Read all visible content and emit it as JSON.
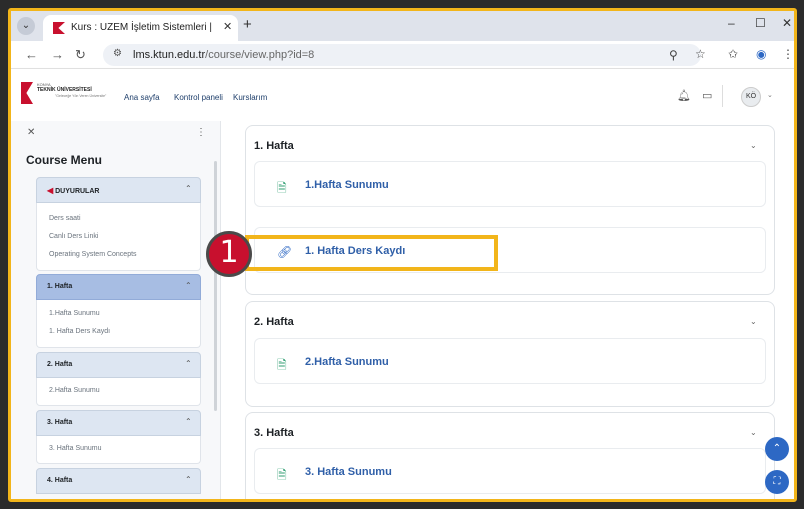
{
  "colors": {
    "accent": "#2d68c4",
    "brand": "#c8102e",
    "highlight": "#f2b51a"
  },
  "browser": {
    "tab_title": "Kurs : UZEM İşletim Sistemleri |",
    "url_host": "lms.ktun.edu.tr",
    "url_path": "/course/view.php?id=8"
  },
  "site": {
    "logo_small": "KONYA",
    "logo_big": "TEKNİK ÜNİVERSİTESİ",
    "logo_tagline": "\"Geleceğe Yön Veren Üniversite\"",
    "nav": [
      "Ana sayfa",
      "Kontrol paneli",
      "Kurslarım"
    ],
    "avatar_initials": "KÖ"
  },
  "drawer": {
    "title": "Course Menu",
    "sections": [
      {
        "label": "DUYURULAR",
        "items": [
          "Ders saati",
          "Canlı Ders Linki",
          "Operating System Concepts"
        ]
      },
      {
        "label": "1. Hafta",
        "active": true,
        "items": [
          "1.Hafta Sunumu",
          "1. Hafta Ders Kaydı"
        ]
      },
      {
        "label": "2. Hafta",
        "items": [
          "2.Hafta Sunumu"
        ]
      },
      {
        "label": "3. Hafta",
        "items": [
          "3. Hafta Sunumu"
        ]
      },
      {
        "label": "4. Hafta",
        "items": []
      }
    ]
  },
  "main": {
    "weeks": [
      {
        "title": "1. Hafta",
        "activities": [
          {
            "label": "1.Hafta Sunumu",
            "icon": "file-icon"
          },
          {
            "label": "1. Hafta Ders Kaydı",
            "icon": "link-icon"
          }
        ]
      },
      {
        "title": "2. Hafta",
        "activities": [
          {
            "label": "2.Hafta Sunumu",
            "icon": "file-icon"
          }
        ]
      },
      {
        "title": "3. Hafta",
        "activities": [
          {
            "label": "3. Hafta Sunumu",
            "icon": "file-icon"
          }
        ]
      }
    ]
  },
  "callout": {
    "number": "1"
  }
}
